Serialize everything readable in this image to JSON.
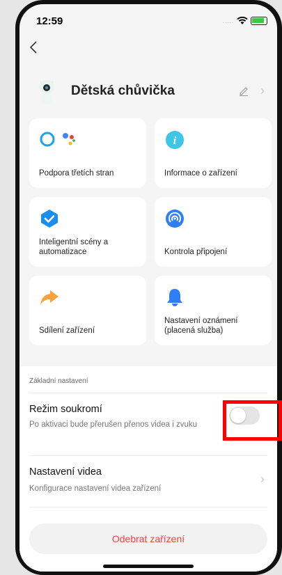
{
  "status_bar": {
    "time": "12:59",
    "signal": "....."
  },
  "header": {
    "device_name": "Dětská chůvička"
  },
  "tiles": [
    {
      "label": "Podpora třetích stran",
      "icon": "assistant-icons"
    },
    {
      "label": "Informace o zařízení",
      "icon": "info-icon"
    },
    {
      "label": "Inteligentní scény a automatizace",
      "icon": "smart-scene-icon"
    },
    {
      "label": "Kontrola připojení",
      "icon": "connection-check-icon"
    },
    {
      "label": "Sdílení zařízení",
      "icon": "share-icon"
    },
    {
      "label": "Nastavení oznámení (placená služba)",
      "icon": "bell-icon"
    }
  ],
  "settings": {
    "section_title": "Základní nastavení",
    "privacy": {
      "title": "Režim soukromí",
      "subtitle": "Po aktivaci bude přerušen přenos videa i zvuku",
      "enabled": false
    },
    "video": {
      "title": "Nastavení videa",
      "subtitle": "Konfigurace nastavení videa zařízení"
    }
  },
  "remove_button": "Odebrat zařízení",
  "colors": {
    "accent_red": "#e84a3a",
    "toggle_off": "#e5e5e5",
    "highlight": "#ff0000"
  }
}
